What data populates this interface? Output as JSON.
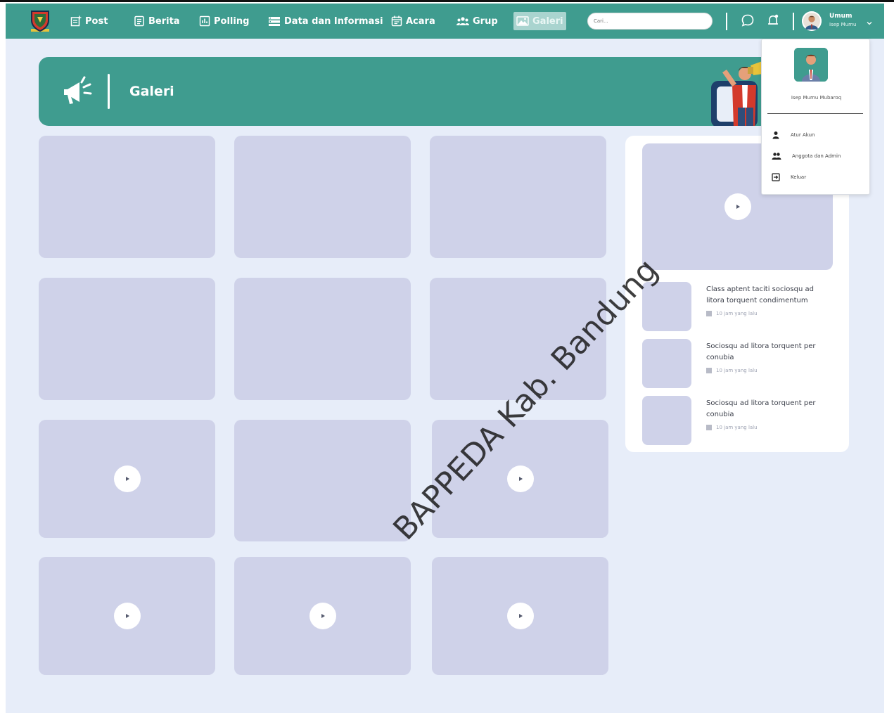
{
  "nav": {
    "items": [
      {
        "label": "Post",
        "icon": "post-icon"
      },
      {
        "label": "Berita",
        "icon": "news-icon"
      },
      {
        "label": "Polling",
        "icon": "polling-icon"
      },
      {
        "label": "Data dan Informasi",
        "icon": "database-icon"
      },
      {
        "label": "Acara",
        "icon": "calendar-icon"
      },
      {
        "label": "Grup",
        "icon": "group-icon"
      },
      {
        "label": "Galeri",
        "icon": "image-icon",
        "active": true
      }
    ],
    "search_placeholder": "Cari...",
    "user_role": "Umum",
    "user_name": "Isep Mumu"
  },
  "banner": {
    "title": "Galeri"
  },
  "gallery": {
    "tiles": [
      {
        "video": false
      },
      {
        "video": false
      },
      {
        "video": false
      },
      {
        "video": false
      },
      {
        "video": false
      },
      {
        "video": false
      },
      {
        "video": true
      },
      {
        "video": false
      },
      {
        "video": true
      },
      {
        "video": true
      },
      {
        "video": true
      },
      {
        "video": true
      }
    ]
  },
  "side": {
    "main_video": true,
    "items": [
      {
        "title": "Class aptent taciti sociosqu ad litora torquent condimentum",
        "time": "10 jam yang lalu"
      },
      {
        "title": "Sociosqu ad litora torquent per conubia",
        "time": "10 jam yang lalu"
      },
      {
        "title": "Sociosqu ad litora torquent per conubia",
        "time": "10 jam yang lalu"
      }
    ]
  },
  "dropdown": {
    "name": "Isep Mumu Mubaroq",
    "items": [
      {
        "label": "Atur Akun",
        "icon": "user-icon"
      },
      {
        "label": "Anggota dan Admin",
        "icon": "users-icon"
      },
      {
        "label": "Keluar",
        "icon": "logout-icon"
      }
    ]
  },
  "watermark": "BAPPEDA Kab. Bandung",
  "colors": {
    "primary": "#3f9c8f",
    "background": "#e7edf9",
    "placeholder": "#cfd2e9"
  }
}
